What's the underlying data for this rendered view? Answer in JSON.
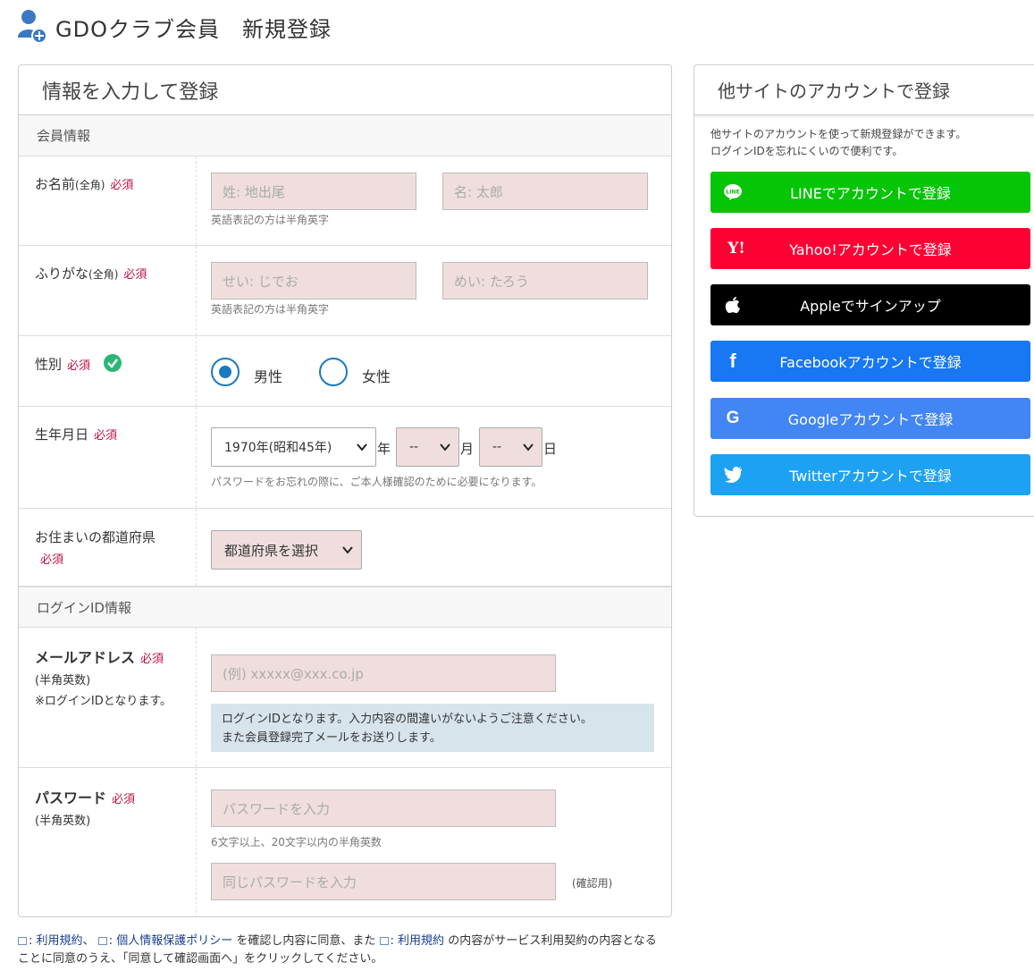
{
  "header": {
    "title": "GDOクラブ会員　新規登録"
  },
  "form_panel": {
    "title": "情報を入力して登録",
    "member_section": "会員情報",
    "login_section": "ログインID情報",
    "required": "必須",
    "name": {
      "label": "お名前",
      "label_small": "(全角)",
      "last_placeholder": "姓: 地出尾",
      "first_placeholder": "名: 太郎",
      "note": "英語表記の方は半角英字"
    },
    "kana": {
      "label": "ふりがな",
      "label_small": "(全角)",
      "last_placeholder": "せい: じでお",
      "first_placeholder": "めい: たろう",
      "note": "英語表記の方は半角英字"
    },
    "gender": {
      "label": "性別",
      "male": "男性",
      "female": "女性",
      "selected": "male"
    },
    "birthday": {
      "label": "生年月日",
      "year": "1970年(昭和45年)",
      "year_unit": "年",
      "month": "--",
      "month_unit": "月",
      "day": "--",
      "day_unit": "日",
      "note": "パスワードをお忘れの際に、ご本人様確認のために必要になります。"
    },
    "prefecture": {
      "label": "お住まいの都道府県",
      "select": "都道府県を選択"
    },
    "email": {
      "label": "メールアドレス",
      "sub1": "(半角英数)",
      "sub2": "※ログインIDとなります。",
      "placeholder": "(例) xxxxx@xxx.co.jp",
      "info_line1": "ログインIDとなります。入力内容の間違いがないようご注意ください。",
      "info_line2": "また会員登録完了メールをお送りします。"
    },
    "password": {
      "label": "パスワード",
      "sub1": "(半角英数)",
      "placeholder": "パスワードを入力",
      "note": "6文字以上、20文字以内の半角英数",
      "confirm_placeholder": "同じパスワードを入力",
      "confirm_note": "(確認用)"
    }
  },
  "footer": {
    "link1": "利用規約",
    "sep1": "、",
    "link2": "個人情報保護ポリシー",
    "text1": " を確認し内容に同意、また ",
    "link3": "利用規約",
    "text2": " の内容がサービス利用契約の内容となる",
    "text3": "ことに同意のうえ、「同意して確認画面へ」をクリックしてください。",
    "prefix": ":"
  },
  "sns_panel": {
    "title": "他サイトのアカウントで登録",
    "desc1": "他サイトのアカウントを使って新規登録ができます。",
    "desc2": "ログインIDを忘れにくいので便利です。",
    "buttons": [
      {
        "label": "LINEでアカウントで登録",
        "icon": "line-icon",
        "icon_text": "LINE",
        "color": "#06c406"
      },
      {
        "label": "Yahoo!アカウントで登録",
        "icon": "yahoo-icon",
        "icon_text": "Y!",
        "color": "#ff0033"
      },
      {
        "label": "Appleでサインアップ",
        "icon": "apple-icon",
        "icon_text": "",
        "color": "#000000"
      },
      {
        "label": "Facebookアカウントで登録",
        "icon": "facebook-icon",
        "icon_text": "f",
        "color": "#1877f2"
      },
      {
        "label": "Googleアカウントで登録",
        "icon": "google-icon",
        "icon_text": "G",
        "color": "#4285f4"
      },
      {
        "label": "Twitterアカウントで登録",
        "icon": "twitter-icon",
        "icon_text": "",
        "color": "#1da1f2"
      }
    ]
  },
  "colors": {
    "accent": "#1a7abf",
    "required": "#c01040",
    "input_bg": "#f0dede",
    "info_bg": "#d7e4ec",
    "check": "#2bb673"
  }
}
